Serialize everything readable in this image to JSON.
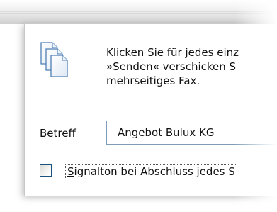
{
  "dialog": {
    "info_lines": [
      "Klicken Sie für jedes einz",
      "»Senden« verschicken S",
      "mehrseitiges Fax."
    ],
    "subject": {
      "label_accel": "B",
      "label_rest": "etreff",
      "value": "Angebot Bulux KG"
    },
    "beep": {
      "checked": false,
      "label_accel": "S",
      "label_rest": "ignalton bei Abschluss jedes S"
    }
  },
  "icons": {
    "pages": "multiple-pages-icon"
  },
  "colors": {
    "input_border": "#7f9db9",
    "checkbox_border": "#1c5180",
    "text": "#111111"
  }
}
